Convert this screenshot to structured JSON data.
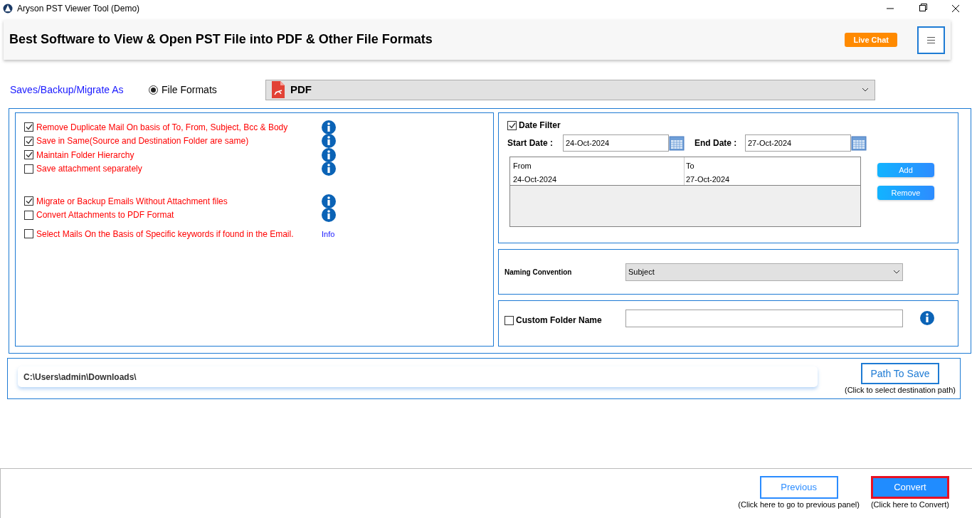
{
  "window": {
    "title": "Aryson PST Viewer Tool (Demo)"
  },
  "header": {
    "title": "Best Software to View & Open PST File into PDF & Other File Formats",
    "live_chat": "Live Chat"
  },
  "save_as": {
    "label": "Saves/Backup/Migrate As",
    "radio": {
      "label": "File Formats",
      "selected": true
    },
    "format": "PDF"
  },
  "option_groups": [
    [
      {
        "label": "Remove Duplicate Mail On basis of To, From, Subject, Bcc & Body",
        "checked": true,
        "kind": "icon"
      },
      {
        "label": "Save in Same(Source and Destination Folder are same)",
        "checked": true,
        "kind": "icon"
      },
      {
        "label": "Maintain Folder Hierarchy",
        "checked": true,
        "kind": "icon"
      },
      {
        "label": "Save attachment separately",
        "checked": false,
        "kind": "icon"
      }
    ],
    [
      {
        "label": "Migrate or Backup Emails Without Attachment files",
        "checked": true,
        "kind": "icon"
      },
      {
        "label": "Convert Attachments to PDF Format",
        "checked": false,
        "kind": "icon"
      },
      {
        "label": "Select Mails On the Basis of Specific keywords if found in the Email.",
        "checked": false,
        "kind": "link",
        "info": "Info"
      }
    ]
  ],
  "date_filter": {
    "label": "Date Filter",
    "checked": true,
    "start_label": "Start Date :",
    "start_value": "24-Oct-2024",
    "end_label": "End Date :",
    "end_value": "27-Oct-2024",
    "table": {
      "columns": [
        "From",
        "To"
      ],
      "rows": [
        [
          "24-Oct-2024",
          "27-Oct-2024"
        ]
      ]
    },
    "buttons": [
      "Add",
      "Remove"
    ]
  },
  "naming": {
    "label": "Naming Convention",
    "value": "Subject"
  },
  "custom_folder": {
    "label": "Custom Folder Name",
    "checked": false
  },
  "path": {
    "value": "C:\\Users\\admin\\Downloads\\",
    "button": "Path To Save",
    "hint": "(Click to select destination path)"
  },
  "footer": {
    "buttons": [
      {
        "label": "Previous",
        "hint": "(Click here to go to previous panel)",
        "kind": "outline"
      },
      {
        "label": "Convert",
        "hint": "(Click here to Convert)",
        "kind": "primary"
      }
    ]
  }
}
